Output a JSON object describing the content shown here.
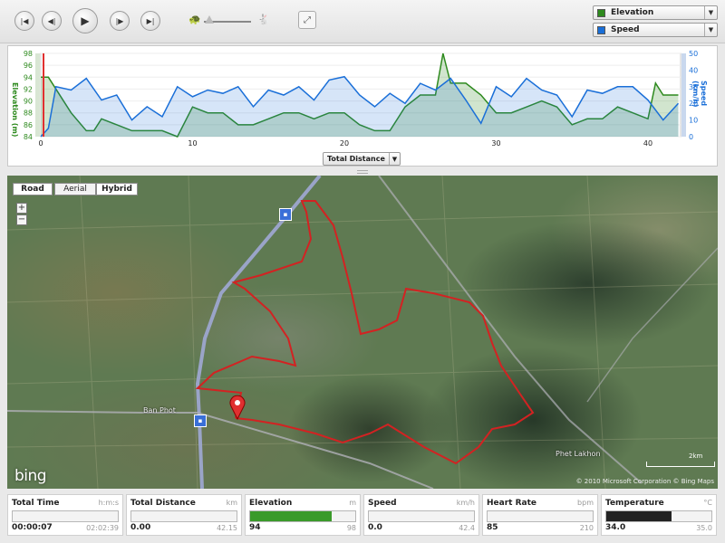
{
  "toolbar": {
    "buttons": [
      {
        "name": "skip-start",
        "icon": "skip-to-start-icon",
        "glyph": "|◀"
      },
      {
        "name": "step-back",
        "icon": "step-back-icon",
        "glyph": "◀|"
      },
      {
        "name": "play",
        "icon": "play-icon",
        "glyph": "▶"
      },
      {
        "name": "step-forward",
        "icon": "step-forward-icon",
        "glyph": "|▶"
      },
      {
        "name": "skip-end",
        "icon": "skip-to-end-icon",
        "glyph": "▶|"
      }
    ],
    "speed_slider_value": 0.1,
    "fullscreen_glyph": "⤢",
    "selectors": [
      {
        "label": "Elevation",
        "color": "#2e8a1e"
      },
      {
        "label": "Speed",
        "color": "#1a6fd8"
      }
    ]
  },
  "chart_data": {
    "type": "area",
    "x_label": "Total Distance",
    "x_ticks": [
      0,
      10,
      20,
      30,
      40
    ],
    "x_range": [
      0,
      42.15
    ],
    "y_left": {
      "label": "Elevation (m)",
      "ticks": [
        84,
        86,
        88,
        90,
        92,
        94,
        96,
        98
      ],
      "range": [
        84,
        98
      ],
      "color": "#2e8a1e"
    },
    "y_right": {
      "label": "Speed (km/h)",
      "ticks": [
        0,
        10,
        20,
        30,
        40,
        50
      ],
      "range": [
        0,
        50
      ],
      "color": "#1a6fd8"
    },
    "series": [
      {
        "name": "Elevation",
        "color": "#2e8a1e",
        "x": [
          0,
          0.5,
          1,
          1.5,
          2,
          3,
          3.5,
          4,
          5,
          6,
          8,
          9,
          10,
          11,
          12,
          13,
          14,
          15,
          16,
          17,
          18,
          19,
          20,
          21,
          22,
          23,
          24,
          25,
          26,
          26.5,
          27,
          28,
          29,
          30,
          31,
          32,
          33,
          34,
          35,
          36,
          37,
          38,
          39,
          40,
          40.5,
          41,
          42
        ],
        "y": [
          94,
          94,
          92,
          90,
          88,
          85,
          85,
          87,
          86,
          85,
          85,
          84,
          89,
          88,
          88,
          86,
          86,
          87,
          88,
          88,
          87,
          88,
          88,
          86,
          85,
          85,
          89,
          91,
          91,
          98,
          93,
          93,
          91,
          88,
          88,
          89,
          90,
          89,
          86,
          87,
          87,
          89,
          88,
          87,
          93,
          91,
          91
        ]
      },
      {
        "name": "Speed",
        "color": "#1a6fd8",
        "x": [
          0,
          0.5,
          1,
          2,
          3,
          4,
          5,
          6,
          7,
          8,
          9,
          10,
          11,
          12,
          13,
          14,
          15,
          16,
          17,
          18,
          19,
          20,
          21,
          22,
          23,
          24,
          25,
          26,
          27,
          28,
          29,
          30,
          31,
          32,
          33,
          34,
          35,
          36,
          37,
          38,
          39,
          40,
          41,
          42
        ],
        "y": [
          0,
          5,
          30,
          28,
          35,
          22,
          25,
          10,
          18,
          12,
          30,
          24,
          28,
          26,
          30,
          18,
          28,
          25,
          30,
          22,
          34,
          36,
          25,
          18,
          26,
          20,
          32,
          28,
          35,
          22,
          8,
          30,
          24,
          35,
          28,
          25,
          12,
          28,
          26,
          30,
          30,
          22,
          10,
          20
        ]
      }
    ]
  },
  "chart_controls": {
    "xaxis_selector": "Total Distance"
  },
  "map": {
    "types": [
      "Road",
      "Aerial",
      "Hybrid"
    ],
    "active_type": "Hybrid",
    "zoom_in": "+",
    "zoom_out": "−",
    "labels": {
      "town_west": "Ban Phot",
      "town_east": "Phet Lakhon"
    },
    "logo": "bing",
    "scale": "2km",
    "copyright": "© 2010 Microsoft Corporation  © Bing Maps"
  },
  "stats": [
    {
      "name": "Total Time",
      "unit": "h:m:s",
      "current": "00:00:07",
      "max": "02:02:39",
      "fill": 0.0,
      "color": "#3a8a2a"
    },
    {
      "name": "Total Distance",
      "unit": "km",
      "current": "0.00",
      "max": "42.15",
      "fill": 0.0,
      "color": "#3a8a2a"
    },
    {
      "name": "Elevation",
      "unit": "m",
      "current": "94",
      "max": "98",
      "fill": 0.78,
      "color": "#3a9a2a"
    },
    {
      "name": "Speed",
      "unit": "km/h",
      "current": "0.0",
      "max": "42.4",
      "fill": 0.0,
      "color": "#1a6fd8"
    },
    {
      "name": "Heart Rate",
      "unit": "bpm",
      "current": "85",
      "max": "210",
      "fill": 0.0,
      "color": "#c0392b"
    },
    {
      "name": "Temperature",
      "unit": "°C",
      "current": "34.0",
      "max": "35.0",
      "fill": 0.62,
      "color": "#222222"
    }
  ]
}
